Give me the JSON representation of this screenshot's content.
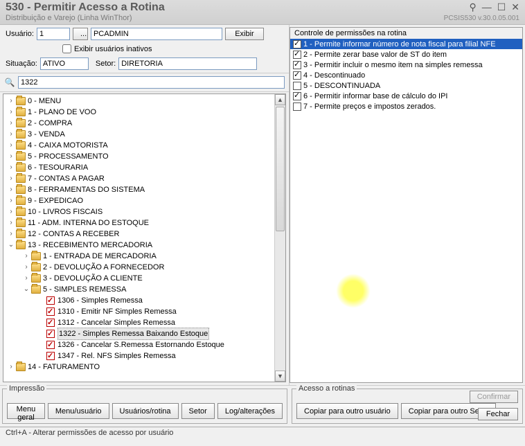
{
  "titlebar": {
    "title": "530 - Permitir Acesso a Rotina",
    "subtitle": "Distribuição e Varejo (Linha WinThor)",
    "version": "PCSIS530   v.30.0.05.001"
  },
  "form": {
    "user_label": "Usuário:",
    "user_code": "1",
    "lookup": "...",
    "user_name": "PCADMIN",
    "show_btn": "Exibir",
    "inactive_label": "Exibir usuários inativos",
    "situacao_label": "Situação:",
    "situacao_value": "ATIVO",
    "setor_label": "Setor:",
    "setor_value": "DIRETORIA",
    "search_value": "1322"
  },
  "tree": [
    {
      "d": 0,
      "t": "f",
      "e": ">",
      "label": "0 - MENU"
    },
    {
      "d": 0,
      "t": "f",
      "e": ">",
      "label": "1 - PLANO DE VOO"
    },
    {
      "d": 0,
      "t": "f",
      "e": ">",
      "label": "2 - COMPRA"
    },
    {
      "d": 0,
      "t": "f",
      "e": ">",
      "label": "3 - VENDA"
    },
    {
      "d": 0,
      "t": "f",
      "e": ">",
      "label": "4 - CAIXA MOTORISTA"
    },
    {
      "d": 0,
      "t": "f",
      "e": ">",
      "label": "5 - PROCESSAMENTO"
    },
    {
      "d": 0,
      "t": "f",
      "e": ">",
      "label": "6 - TESOURARIA"
    },
    {
      "d": 0,
      "t": "f",
      "e": ">",
      "label": "7 - CONTAS A PAGAR"
    },
    {
      "d": 0,
      "t": "f",
      "e": ">",
      "label": "8 - FERRAMENTAS DO SISTEMA"
    },
    {
      "d": 0,
      "t": "f",
      "e": ">",
      "label": "9 - EXPEDICAO"
    },
    {
      "d": 0,
      "t": "f",
      "e": ">",
      "label": "10 - LIVROS FISCAIS"
    },
    {
      "d": 0,
      "t": "f",
      "e": ">",
      "label": "11 - ADM. INTERNA DO ESTOQUE"
    },
    {
      "d": 0,
      "t": "f",
      "e": ">",
      "label": "12 - CONTAS A RECEBER"
    },
    {
      "d": 0,
      "t": "f",
      "e": "v",
      "label": "13 - RECEBIMENTO MERCADORIA"
    },
    {
      "d": 1,
      "t": "f",
      "e": ">",
      "label": "1 - ENTRADA DE MERCADORIA"
    },
    {
      "d": 1,
      "t": "f",
      "e": ">",
      "label": "2 - DEVOLUÇÃO A FORNECEDOR"
    },
    {
      "d": 1,
      "t": "f",
      "e": ">",
      "label": "3 - DEVOLUÇÃO A CLIENTE"
    },
    {
      "d": 1,
      "t": "f",
      "e": "v",
      "label": "5 - SIMPLES REMESSA"
    },
    {
      "d": 2,
      "t": "c",
      "chk": true,
      "label": "1306 - Simples Remessa"
    },
    {
      "d": 2,
      "t": "c",
      "chk": true,
      "label": "1310 - Emitir NF Simples Remessa"
    },
    {
      "d": 2,
      "t": "c",
      "chk": true,
      "label": "1312 - Cancelar Simples Remessa"
    },
    {
      "d": 2,
      "t": "c",
      "chk": true,
      "sel": true,
      "label": "1322 - Simples Remessa Baixando Estoque"
    },
    {
      "d": 2,
      "t": "c",
      "chk": true,
      "label": "1326 - Cancelar S.Remessa Estornando Estoque"
    },
    {
      "d": 2,
      "t": "c",
      "chk": true,
      "label": "1347 - Rel. NFS Simples Remessa"
    },
    {
      "d": 0,
      "t": "f",
      "e": ">",
      "label": "14 - FATURAMENTO"
    }
  ],
  "perm": {
    "title": "Controle de permissões na rotina",
    "items": [
      {
        "chk": true,
        "hl": true,
        "label": "1 - Permite informar número de nota fiscal para filial NFE"
      },
      {
        "chk": true,
        "label": "2 - Permite zerar base valor de ST do item"
      },
      {
        "chk": true,
        "label": "3 - Permitir incluir o mesmo item na simples remessa"
      },
      {
        "chk": true,
        "label": "4 - Descontinuado"
      },
      {
        "chk": false,
        "label": "5 - DESCONTINUADA"
      },
      {
        "chk": true,
        "label": "6 - Permitir informar base de cálculo do IPI"
      },
      {
        "chk": false,
        "label": "7 - Permite preços e impostos zerados."
      }
    ]
  },
  "bottom": {
    "impressao": "Impressão",
    "acesso": "Acesso a rotinas",
    "b1": "Menu geral",
    "b2": "Menu/usuário",
    "b3": "Usuários/rotina",
    "b4": "Setor",
    "b5": "Log/alterações",
    "b6": "Copiar para outro usuário",
    "b7": "Copiar para outro Setor",
    "b8": "Confirmar",
    "b9": "Fechar"
  },
  "status": "Ctrl+A - Alterar permissões de acesso por usuário"
}
